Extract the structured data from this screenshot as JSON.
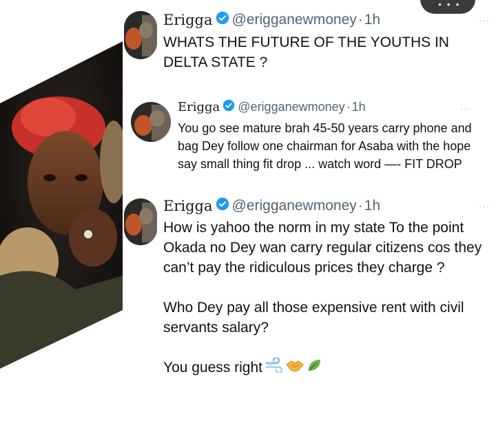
{
  "tweets": [
    {
      "author": "Erigga",
      "handle": "@erigganewmoney",
      "separator": "·",
      "time": "1h",
      "more": "···",
      "text": "WHATS THE FUTURE OF THE YOUTHS IN DELTA STATE ?"
    },
    {
      "author": "Erigga",
      "handle": "@erigganewmoney",
      "separator": "·",
      "time": "1h",
      "more": "···",
      "text": "You go see mature brah 45-50 years carry phone and bag Dey follow one chairman for Asaba with the hope say small thing fit drop ... watch word —- FIT DROP"
    },
    {
      "author": "Erigga",
      "handle": "@erigganewmoney",
      "separator": "·",
      "time": "1h",
      "more": "···",
      "paragraphs": [
        "How is yahoo the norm in my state To the point Okada no Dey wan carry regular citizens cos they can’t pay the ridiculous prices they charge ?",
        "Who Dey pay all those expensive rent with civil servants salary?",
        "You guess right"
      ],
      "emojis": [
        "dash-emoji",
        "handshake-emoji",
        "leaf-emoji"
      ]
    }
  ],
  "colors": {
    "verified": "#1d9bf0",
    "handle": "#536471",
    "text": "#111111",
    "hair": "#d8342a"
  }
}
